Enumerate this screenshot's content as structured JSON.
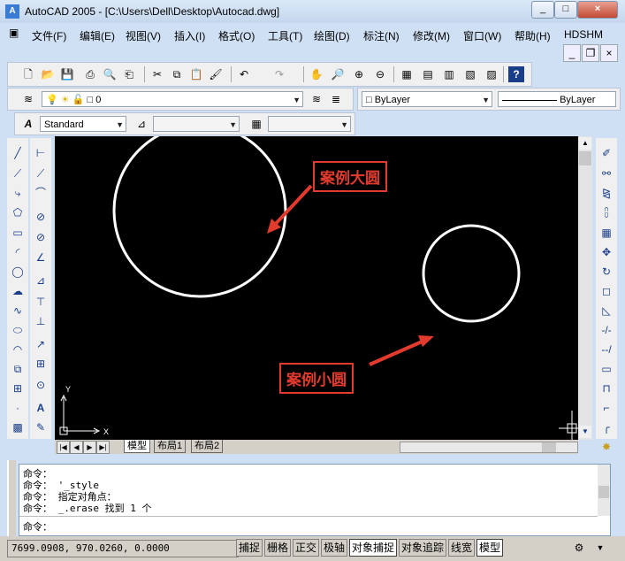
{
  "window": {
    "title": "AutoCAD 2005 - [C:\\Users\\Dell\\Desktop\\Autocad.dwg]",
    "app_icon_label": "A",
    "minimize": "_",
    "maximize": "□",
    "close": "×"
  },
  "menu": [
    {
      "label": "文件(F)"
    },
    {
      "label": "编辑(E)"
    },
    {
      "label": "视图(V)"
    },
    {
      "label": "插入(I)"
    },
    {
      "label": "格式(O)"
    },
    {
      "label": "工具(T)"
    },
    {
      "label": "绘图(D)"
    },
    {
      "label": "标注(N)"
    },
    {
      "label": "修改(M)"
    },
    {
      "label": "窗口(W)"
    },
    {
      "label": "帮助(H)"
    },
    {
      "label": "HDSHM"
    }
  ],
  "doc_controls": {
    "minimize": "_",
    "restore": "❐",
    "close": "×"
  },
  "layers": {
    "current_layer": "0",
    "color": "ByLayer",
    "linetype": "ByLayer"
  },
  "styles": {
    "text_style": "Standard"
  },
  "annotations": {
    "big_circle": "案例大圆",
    "small_circle": "案例小圆"
  },
  "ucs": {
    "x_label": "X",
    "y_label": "Y"
  },
  "layout_tabs": [
    {
      "label": "模型",
      "active": true
    },
    {
      "label": "布局1",
      "active": false
    },
    {
      "label": "布局2",
      "active": false
    }
  ],
  "command_history": [
    "命令：",
    "命令： '_style",
    "命令： 指定对角点：",
    "命令： _.erase 找到 1 个"
  ],
  "command_prompt": "命令：",
  "status": {
    "coordinates": "7699.0908, 970.0260, 0.0000",
    "toggles": [
      {
        "label": "捕捉",
        "on": false
      },
      {
        "label": "栅格",
        "on": false
      },
      {
        "label": "正交",
        "on": false
      },
      {
        "label": "极轴",
        "on": false
      },
      {
        "label": "对象捕捉",
        "on": true
      },
      {
        "label": "对象追踪",
        "on": false
      },
      {
        "label": "线宽",
        "on": false
      },
      {
        "label": "模型",
        "on": true
      }
    ]
  },
  "colors": {
    "canvas": "#000000",
    "circle": "#ffffff",
    "callout": "#e23b2e",
    "titlebar": "#cfe0f4"
  }
}
